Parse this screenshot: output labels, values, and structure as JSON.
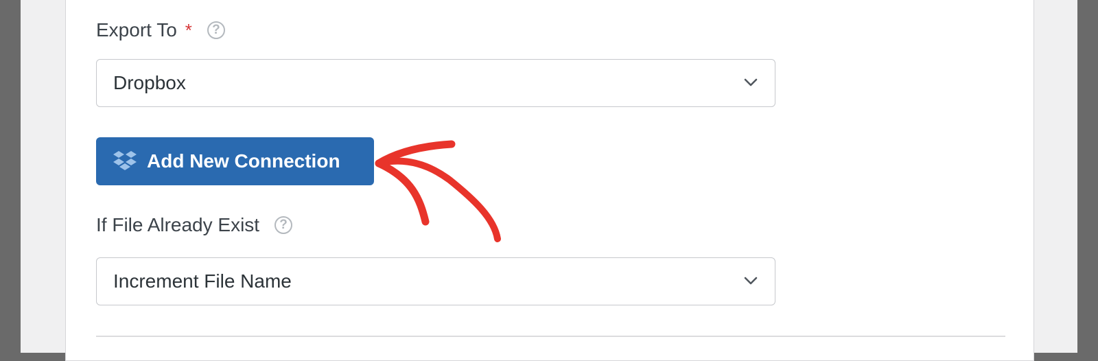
{
  "export_to": {
    "label": "Export To",
    "required_mark": "*",
    "help_icon": "question-circle-icon",
    "selected_value": "Dropbox",
    "chevron_icon": "chevron-down-icon"
  },
  "add_connection": {
    "label": "Add New Connection",
    "icon": "dropbox-icon"
  },
  "if_file_exists": {
    "label": "If File Already Exist",
    "help_icon": "question-circle-icon",
    "selected_value": "Increment File Name",
    "chevron_icon": "chevron-down-icon"
  },
  "colors": {
    "button_bg": "#2a6ab0",
    "required": "#d63638",
    "annotation_arrow": "#e8342b"
  }
}
